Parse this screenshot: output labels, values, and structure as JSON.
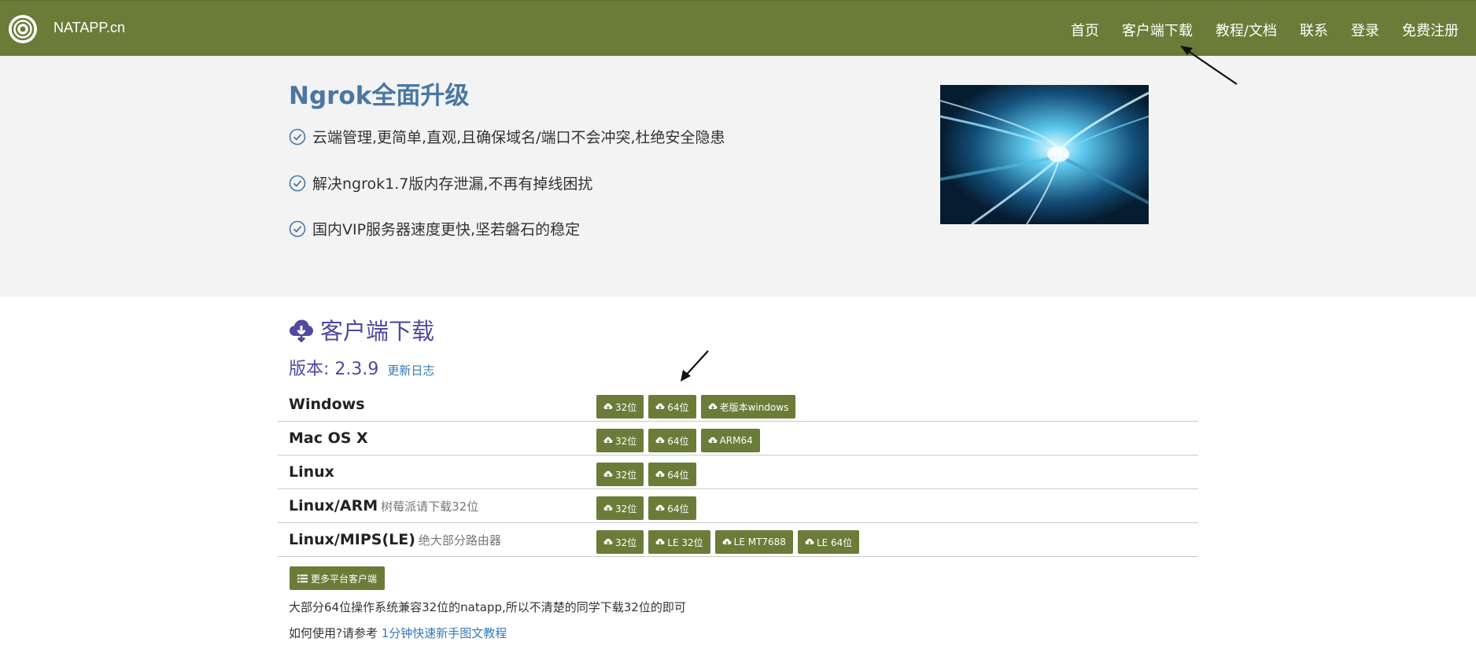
{
  "navbar": {
    "brand": "NATAPP.cn",
    "links": [
      "首页",
      "客户端下载",
      "教程/文档",
      "联系",
      "登录",
      "免费注册"
    ]
  },
  "hero": {
    "title": "Ngrok全面升级",
    "features": [
      "云端管理,更简单,直观,且确保域名/端口不会冲突,杜绝安全隐患",
      "解决ngrok1.7版内存泄漏,不再有掉线困扰",
      "国内VIP服务器速度更快,坚若磐石的稳定"
    ]
  },
  "download": {
    "title": "客户端下载",
    "version_label": "版本: 2.3.9",
    "changelog": "更新日志",
    "rows": [
      {
        "os": "Windows",
        "note": "",
        "buttons": [
          "32位",
          "64位",
          "老版本windows"
        ]
      },
      {
        "os": "Mac OS X",
        "note": "",
        "buttons": [
          "32位",
          "64位",
          "ARM64"
        ]
      },
      {
        "os": "Linux",
        "note": "",
        "buttons": [
          "32位",
          "64位"
        ]
      },
      {
        "os": "Linux/ARM",
        "note": "树莓派请下载32位",
        "buttons": [
          "32位",
          "64位"
        ]
      },
      {
        "os": "Linux/MIPS(LE)",
        "note": "绝大部分路由器",
        "buttons": [
          "32位",
          "LE 32位",
          "LE MT7688",
          "LE 64位"
        ]
      }
    ],
    "more_button": "更多平台客户端",
    "note1": "大部分64位操作系统兼容32位的natapp,所以不清楚的同学下载32位的即可",
    "note2_prefix": "如何使用?请参考",
    "note2_link": "1分钟快速新手图文教程"
  },
  "colors": {
    "navbar": "#6a7c38",
    "button": "#6a7c38",
    "hero_title": "#4a77a3",
    "section_title": "#4f4aa0",
    "link": "#337ab7"
  }
}
